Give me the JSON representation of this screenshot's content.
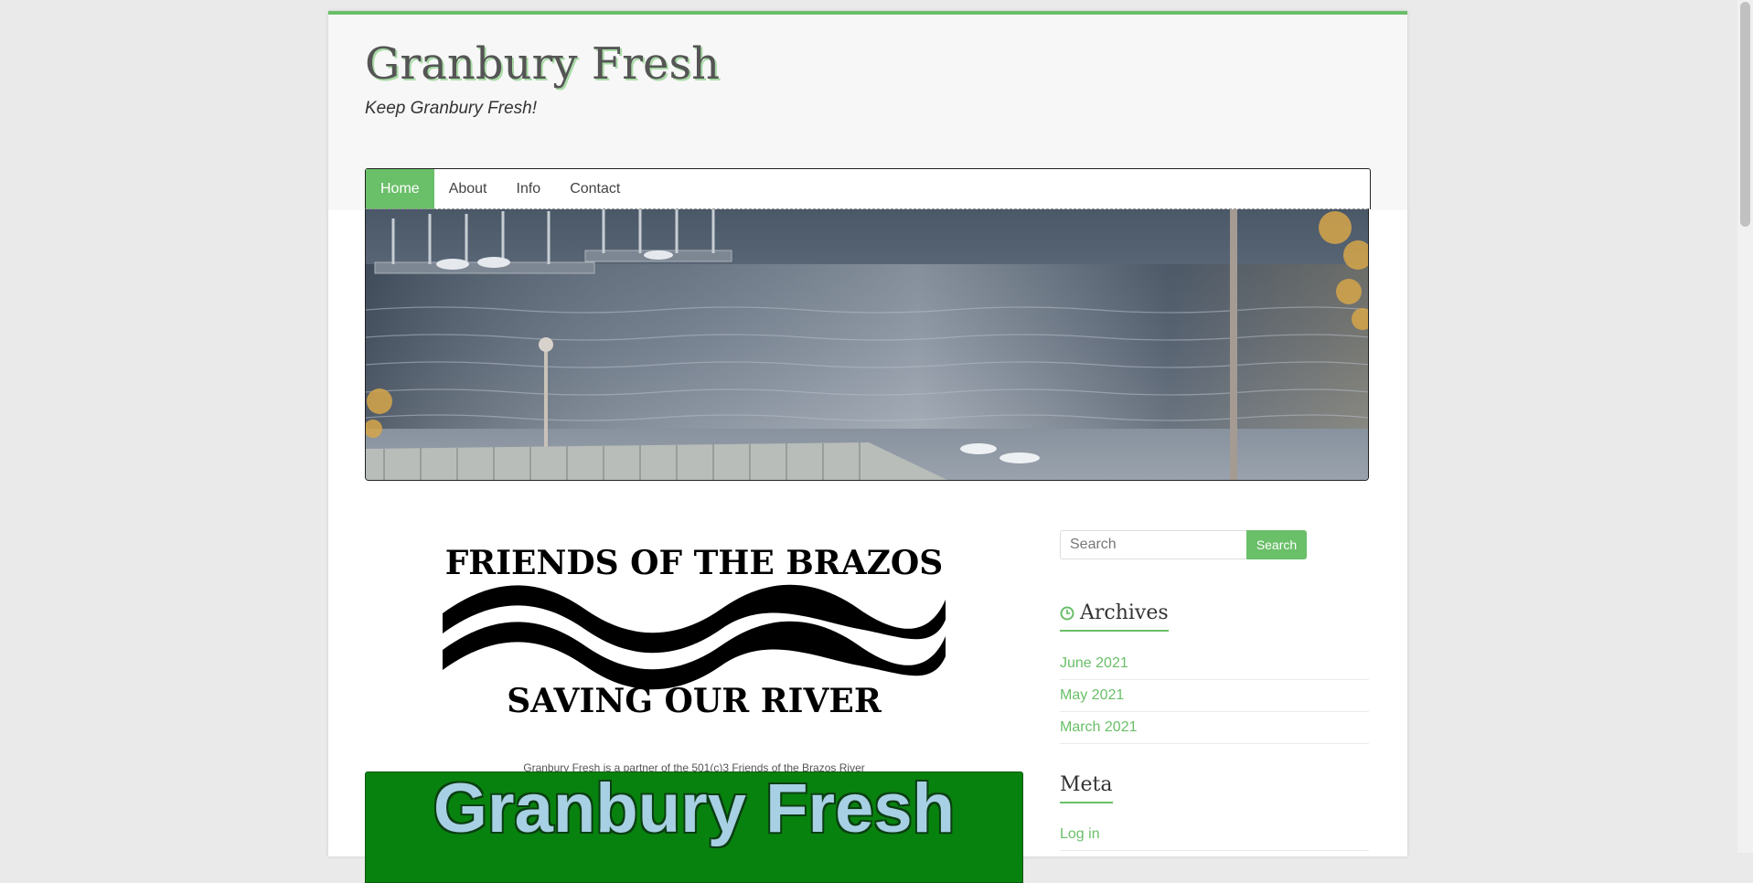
{
  "site": {
    "title": "Granbury Fresh",
    "tagline": "Keep Granbury Fresh!"
  },
  "nav": {
    "items": [
      {
        "label": "Home",
        "active": true
      },
      {
        "label": "About",
        "active": false
      },
      {
        "label": "Info",
        "active": false
      },
      {
        "label": "Contact",
        "active": false
      }
    ]
  },
  "main": {
    "logo_text_top": "FRIENDS OF THE BRAZOS",
    "logo_text_bottom": "SAVING OUR RIVER",
    "caption": "Granbury Fresh is a partner of the 501(c)3 Friends of the Brazos River",
    "banner_text": "Granbury Fresh"
  },
  "sidebar": {
    "search": {
      "placeholder": "Search",
      "button_label": "Search"
    },
    "archives": {
      "title": "Archives",
      "icon": "clock-icon",
      "items": [
        "June 2021",
        "May 2021",
        "March 2021"
      ]
    },
    "meta": {
      "title": "Meta",
      "items": [
        "Log in"
      ]
    }
  },
  "colors": {
    "accent": "#6abf69",
    "page_bg": "#eaeaea",
    "banner_green": "#08820e",
    "banner_text": "#a8d0e4"
  }
}
